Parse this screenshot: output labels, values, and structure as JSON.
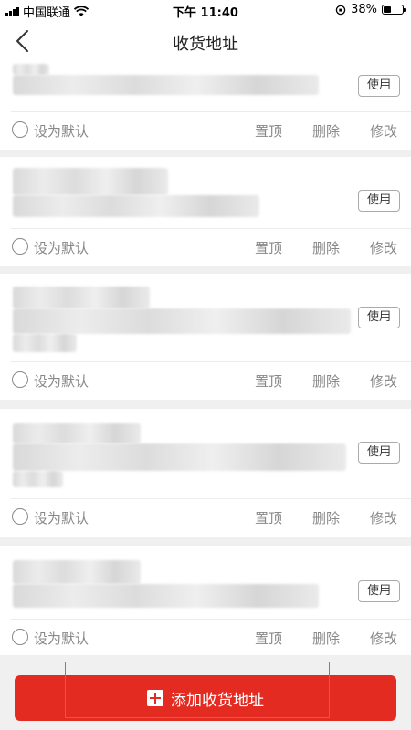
{
  "status_bar": {
    "carrier": "中国联通",
    "time": "下午 11:40",
    "battery_text": "38%",
    "battery_level": 0.38
  },
  "nav": {
    "title": "收货地址",
    "back_icon": "chevron-left-icon"
  },
  "addresses": [
    {
      "use_label": "使用",
      "default_label": "设为默认",
      "top_label": "置顶",
      "delete_label": "删除",
      "edit_label": "修改"
    },
    {
      "use_label": "使用",
      "default_label": "设为默认",
      "top_label": "置顶",
      "delete_label": "删除",
      "edit_label": "修改"
    },
    {
      "use_label": "使用",
      "default_label": "设为默认",
      "top_label": "置顶",
      "delete_label": "删除",
      "edit_label": "修改"
    },
    {
      "use_label": "使用",
      "default_label": "设为默认",
      "top_label": "置顶",
      "delete_label": "删除",
      "edit_label": "修改"
    },
    {
      "use_label": "使用",
      "default_label": "设为默认",
      "top_label": "置顶",
      "delete_label": "删除",
      "edit_label": "修改"
    }
  ],
  "add_button": {
    "label": "添加收货地址",
    "icon": "plus-square-icon"
  },
  "colors": {
    "accent": "#e32b22",
    "highlight": "#3fae3f"
  }
}
